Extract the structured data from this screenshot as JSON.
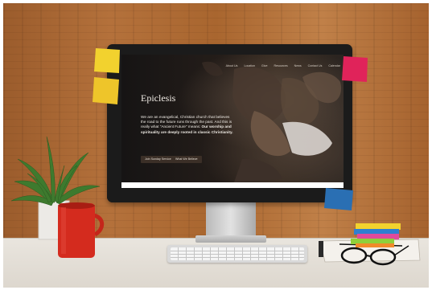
{
  "website": {
    "title": "Epiclesis",
    "nav": [
      "About Us",
      "Location",
      "Give",
      "Resources",
      "News",
      "Contact Us",
      "Calendar"
    ],
    "intro_text": "We are an evangelical, Christian church that believes the road to the future runs through the past. And this is really what \"Ancient Future\" means:",
    "intro_bold": "Our worship and spirituality are deeply rooted in classic Christianity.",
    "buttons": [
      "Join Sunday Service",
      "What We Believe"
    ]
  },
  "scene": {
    "description_icons": [
      "plant-icon",
      "mug-icon",
      "keyboard-icon",
      "glasses-icon",
      "sticky-notes-icon"
    ]
  },
  "colors": {
    "wall": "#a9662f",
    "desk": "#e4dfd7",
    "mug": "#d42b1e",
    "sticky_yellow": "#f2d22e",
    "sticky_pink": "#e0235a",
    "sticky_blue": "#2a6fb3"
  }
}
